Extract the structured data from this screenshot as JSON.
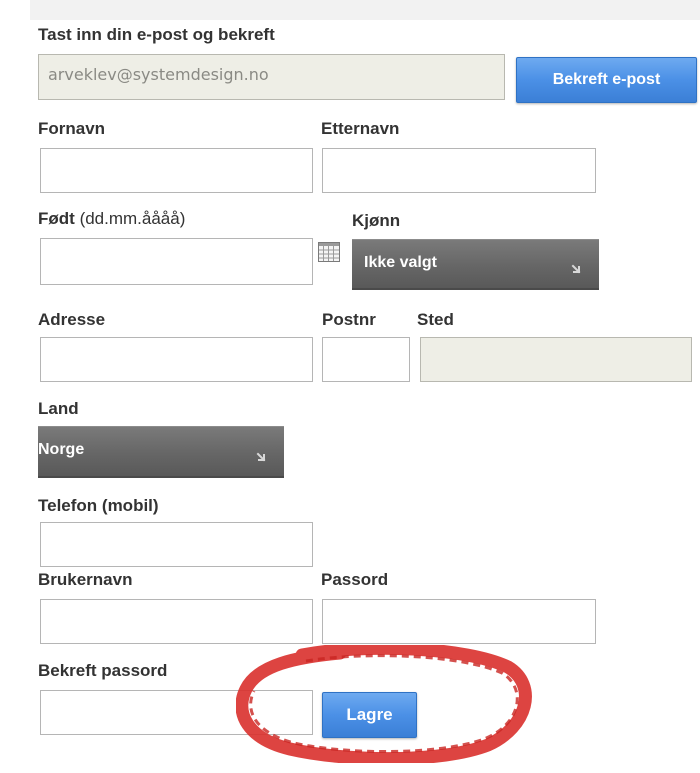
{
  "email_section": {
    "label": "Tast inn din e-post og bekreft",
    "email_value": "arveklev@systemdesign.no",
    "confirm_button": "Bekreft e-post"
  },
  "name": {
    "first_label": "Fornavn",
    "last_label": "Etternavn"
  },
  "birth": {
    "label": "Født",
    "hint": "(dd.mm.åååå)",
    "calendar_icon": "calendar-icon"
  },
  "gender": {
    "label": "Kjønn",
    "selected": "Ikke valgt"
  },
  "address": {
    "address_label": "Adresse",
    "postnr_label": "Postnr",
    "place_label": "Sted"
  },
  "country": {
    "label": "Land",
    "selected": "Norge"
  },
  "phone": {
    "label": "Telefon (mobil)"
  },
  "account": {
    "username_label": "Brukernavn",
    "password_label": "Passord",
    "confirm_password_label": "Bekreft passord"
  },
  "save_button": "Lagre",
  "colors": {
    "button_blue": "#4b90e6",
    "select_gray": "#666666",
    "readonly_field": "#eeeee6",
    "annotation_red": "#d9302c"
  },
  "annotation": {
    "type": "hand-drawn red circle around save button"
  }
}
